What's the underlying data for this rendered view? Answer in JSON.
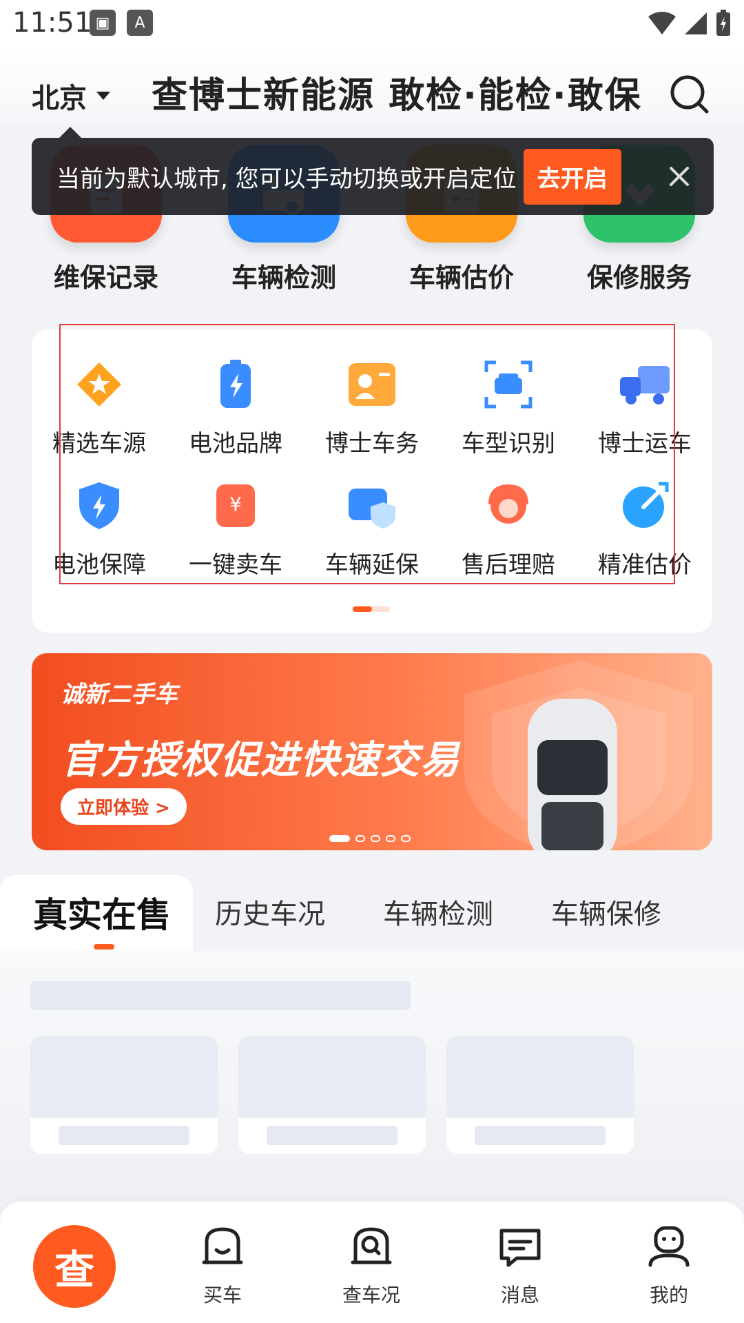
{
  "status_bar": {
    "time": "11:51"
  },
  "header": {
    "city": "北京",
    "brand": "查博士新能源 敢检·能检·敢保"
  },
  "quick_items": [
    {
      "label": "维保记录",
      "icon": "clipboard-icon",
      "color": "#ff5a34"
    },
    {
      "label": "车辆检测",
      "icon": "inspect-car-icon",
      "color": "#2a8cff"
    },
    {
      "label": "车辆估价",
      "icon": "calculator-icon",
      "color": "#ff9a1a"
    },
    {
      "label": "保修服务",
      "icon": "wrench-icon",
      "color": "#2ec26b"
    }
  ],
  "tooltip": {
    "text": "当前为默认城市, 您可以手动切换或开启定位",
    "button": "去开启"
  },
  "services": [
    {
      "label": "精选车源",
      "icon": "star-tag-icon"
    },
    {
      "label": "电池品牌",
      "icon": "battery-icon"
    },
    {
      "label": "博士车务",
      "icon": "id-card-icon"
    },
    {
      "label": "车型识别",
      "icon": "car-scan-icon"
    },
    {
      "label": "博士运车",
      "icon": "truck-icon"
    },
    {
      "label": "电池保障",
      "icon": "battery-shield-icon"
    },
    {
      "label": "一键卖车",
      "icon": "sell-car-icon"
    },
    {
      "label": "车辆延保",
      "icon": "car-shield-icon"
    },
    {
      "label": "售后理赔",
      "icon": "customer-service-icon"
    },
    {
      "label": "精准估价",
      "icon": "target-icon"
    }
  ],
  "banner": {
    "logo": "诚新二手车",
    "title": "官方授权促进快速交易",
    "button": "立即体验 >"
  },
  "tabs": [
    "真实在售",
    "历史车况",
    "车辆检测",
    "车辆保修"
  ],
  "bottom_nav": {
    "fab": "查",
    "items": [
      "买车",
      "查车况",
      "消息",
      "我的"
    ]
  }
}
